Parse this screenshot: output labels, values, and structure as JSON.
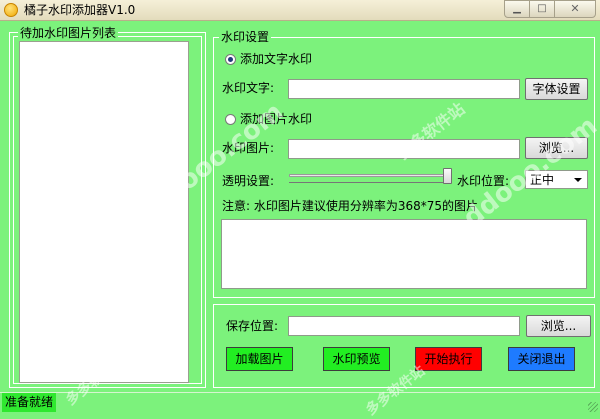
{
  "window": {
    "title": "橘子水印添加器V1.0",
    "minimize_glyph": "▁",
    "maximize_glyph": "□",
    "close_glyph": "✕"
  },
  "left_panel": {
    "title": "待加水印图片列表"
  },
  "settings": {
    "title": "水印设置",
    "text_mode": {
      "label": "添加文字水印",
      "checked": true
    },
    "watermark_text": {
      "label": "水印文字:",
      "value": ""
    },
    "font_button": "字体设置",
    "image_mode": {
      "label": "添加图片水印",
      "checked": false
    },
    "watermark_image": {
      "label": "水印图片:",
      "value": ""
    },
    "browse_button": "浏览...",
    "transparency": {
      "label": "透明设置:",
      "level": 1.0
    },
    "position": {
      "label": "水印位置:",
      "selected": "正中"
    },
    "note": "注意: 水印图片建议使用分辨率为368*75的图片"
  },
  "save": {
    "label": "保存位置:",
    "value": "",
    "browse_button": "浏览..."
  },
  "actions": {
    "load": {
      "label": "加载图片",
      "color": "#22ee22"
    },
    "preview": {
      "label": "水印预览",
      "color": "#22ee22"
    },
    "start": {
      "label": "开始执行",
      "color": "#ff0000"
    },
    "exit": {
      "label": "关闭退出",
      "color": "#1e7bff"
    }
  },
  "status": {
    "text": "准备就绪"
  },
  "watermark": {
    "brand": "多多软件站",
    "url": "www.ddooo.com"
  }
}
